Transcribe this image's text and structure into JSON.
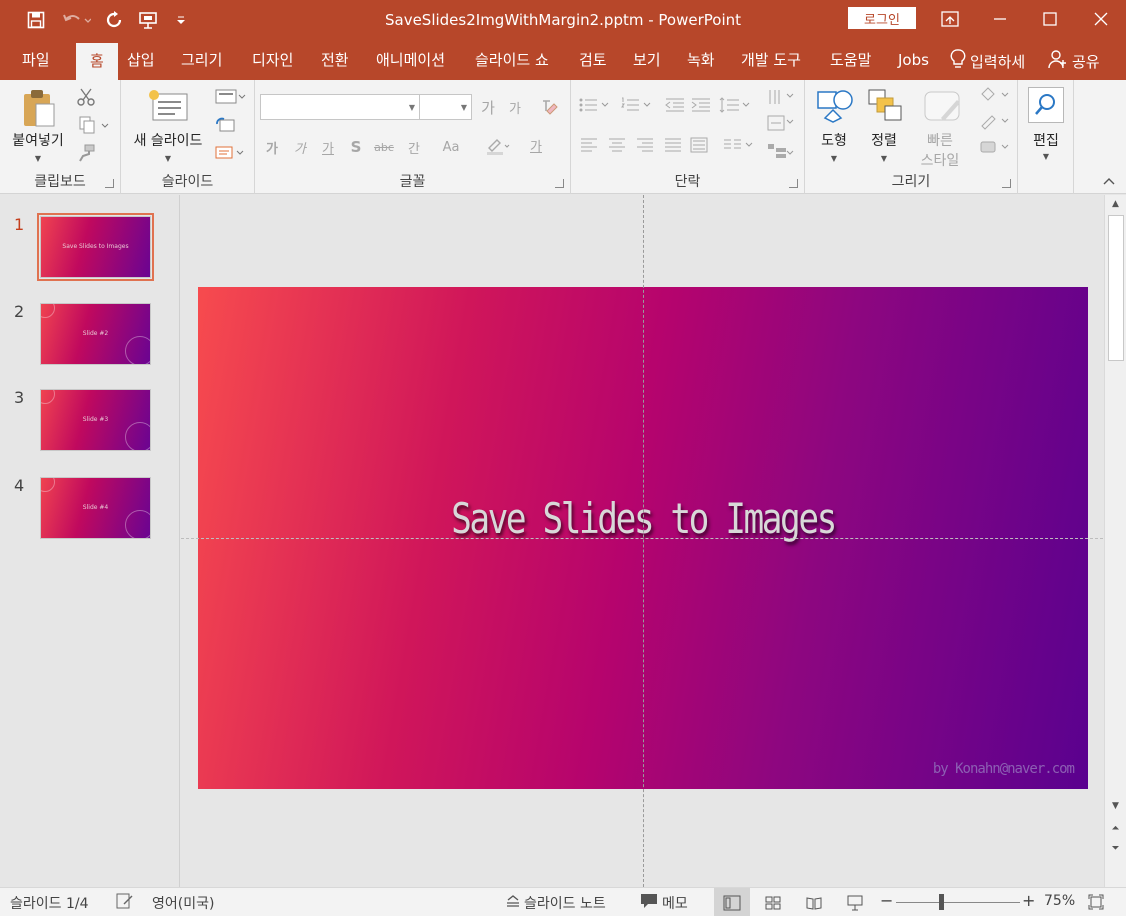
{
  "window": {
    "title": "SaveSlides2ImgWithMargin2.pptm  -  PowerPoint",
    "login_label": "로그인",
    "accent": "#b7472a"
  },
  "quick_access": [
    "save-icon",
    "undo-icon",
    "redo-icon",
    "present-from-start-icon",
    "customize-icon"
  ],
  "tabs": [
    {
      "label": "파일"
    },
    {
      "label": "홈",
      "active": true
    },
    {
      "label": "삽입"
    },
    {
      "label": "그리기"
    },
    {
      "label": "디자인"
    },
    {
      "label": "전환"
    },
    {
      "label": "애니메이션"
    },
    {
      "label": "슬라이드 쇼"
    },
    {
      "label": "검토"
    },
    {
      "label": "보기"
    },
    {
      "label": "녹화"
    },
    {
      "label": "개발 도구"
    },
    {
      "label": "도움말"
    },
    {
      "label": "Jobs"
    }
  ],
  "tell_me": "입력하세",
  "share": "공유",
  "ribbon": {
    "clipboard": {
      "label": "클립보드",
      "paste": "붙여넣기"
    },
    "slides": {
      "label": "슬라이드",
      "new_slide": "새 슬라이드"
    },
    "font": {
      "label": "글꼴",
      "font_name": "",
      "font_size": "",
      "buttons": {
        "grow": "가",
        "shrink": "가",
        "bold": "가",
        "italic": "가",
        "underline": "가",
        "shadow": "S",
        "strike": "abc",
        "spacing": "간",
        "case": "Aa",
        "color": "가"
      }
    },
    "paragraph": {
      "label": "단락"
    },
    "drawing": {
      "label": "그리기",
      "shapes": "도형",
      "arrange": "정렬",
      "quick_styles_1": "빠른",
      "quick_styles_2": "스타일"
    },
    "editing": {
      "label": "편집"
    }
  },
  "slides": [
    {
      "num": "1",
      "title": "Save Slides to Images",
      "selected": true
    },
    {
      "num": "2",
      "title": "Slide #2"
    },
    {
      "num": "3",
      "title": "Slide #3"
    },
    {
      "num": "4",
      "title": "Slide #4"
    }
  ],
  "current_slide": {
    "title": "Save Slides to Images",
    "credit": "by Konahn@naver.com"
  },
  "status": {
    "slide_counter": "슬라이드 1/4",
    "language": "영어(미국)",
    "notes": "슬라이드 노트",
    "comments": "메모",
    "zoom": "75%",
    "zoom_level": 0.75
  }
}
